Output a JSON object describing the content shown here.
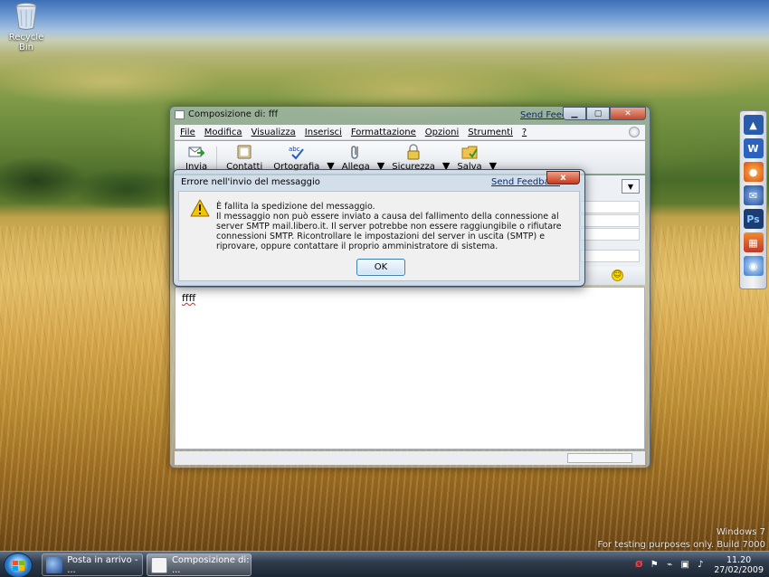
{
  "desktop": {
    "recycle_bin_label": "Recycle Bin",
    "watermark_line1": "Windows 7",
    "watermark_line2": "For testing purposes only. Build 7000"
  },
  "compose": {
    "title": "Composizione di: fff",
    "send_feedback": "Send Feedback",
    "menu": [
      "File",
      "Modifica",
      "Visualizza",
      "Inserisci",
      "Formattazione",
      "Opzioni",
      "Strumenti",
      "?"
    ],
    "toolbar": {
      "send": "Invia",
      "contacts": "Contatti",
      "spelling": "Ortografia",
      "spelling_badge": "abc",
      "attach": "Allega",
      "security": "Sicurezza",
      "save": "Salva"
    },
    "body_text": "ffff"
  },
  "dialog": {
    "title": "Errore nell'invio del messaggio",
    "send_feedback": "Send Feedback",
    "close_glyph": "x",
    "line1": "È fallita la spedizione del messaggio.",
    "line2": "Il messaggio non può essere inviato a causa del fallimento della connessione al server SMTP mail.libero.it. Il server potrebbe non essere raggiungibile o rifiutare connessioni SMTP. Ricontrollare le impostazioni del server in uscita (SMTP) e riprovare, oppure contattare il proprio amministratore di sistema.",
    "ok": "OK"
  },
  "taskbar": {
    "tasks": [
      "Posta in arrivo - ...",
      "Composizione di: ..."
    ],
    "time": "11.20",
    "date": "27/02/2009"
  },
  "icons": {
    "dock": [
      "outlook-icon",
      "word-icon",
      "firefox-icon",
      "thunderbird-icon",
      "photoshop-icon",
      "gallery-icon",
      "globe-icon"
    ]
  },
  "colors": {
    "accent": "#2f7dc9",
    "close_red": "#c53a1e",
    "link": "#102a6b",
    "warning": "#f5c400"
  }
}
